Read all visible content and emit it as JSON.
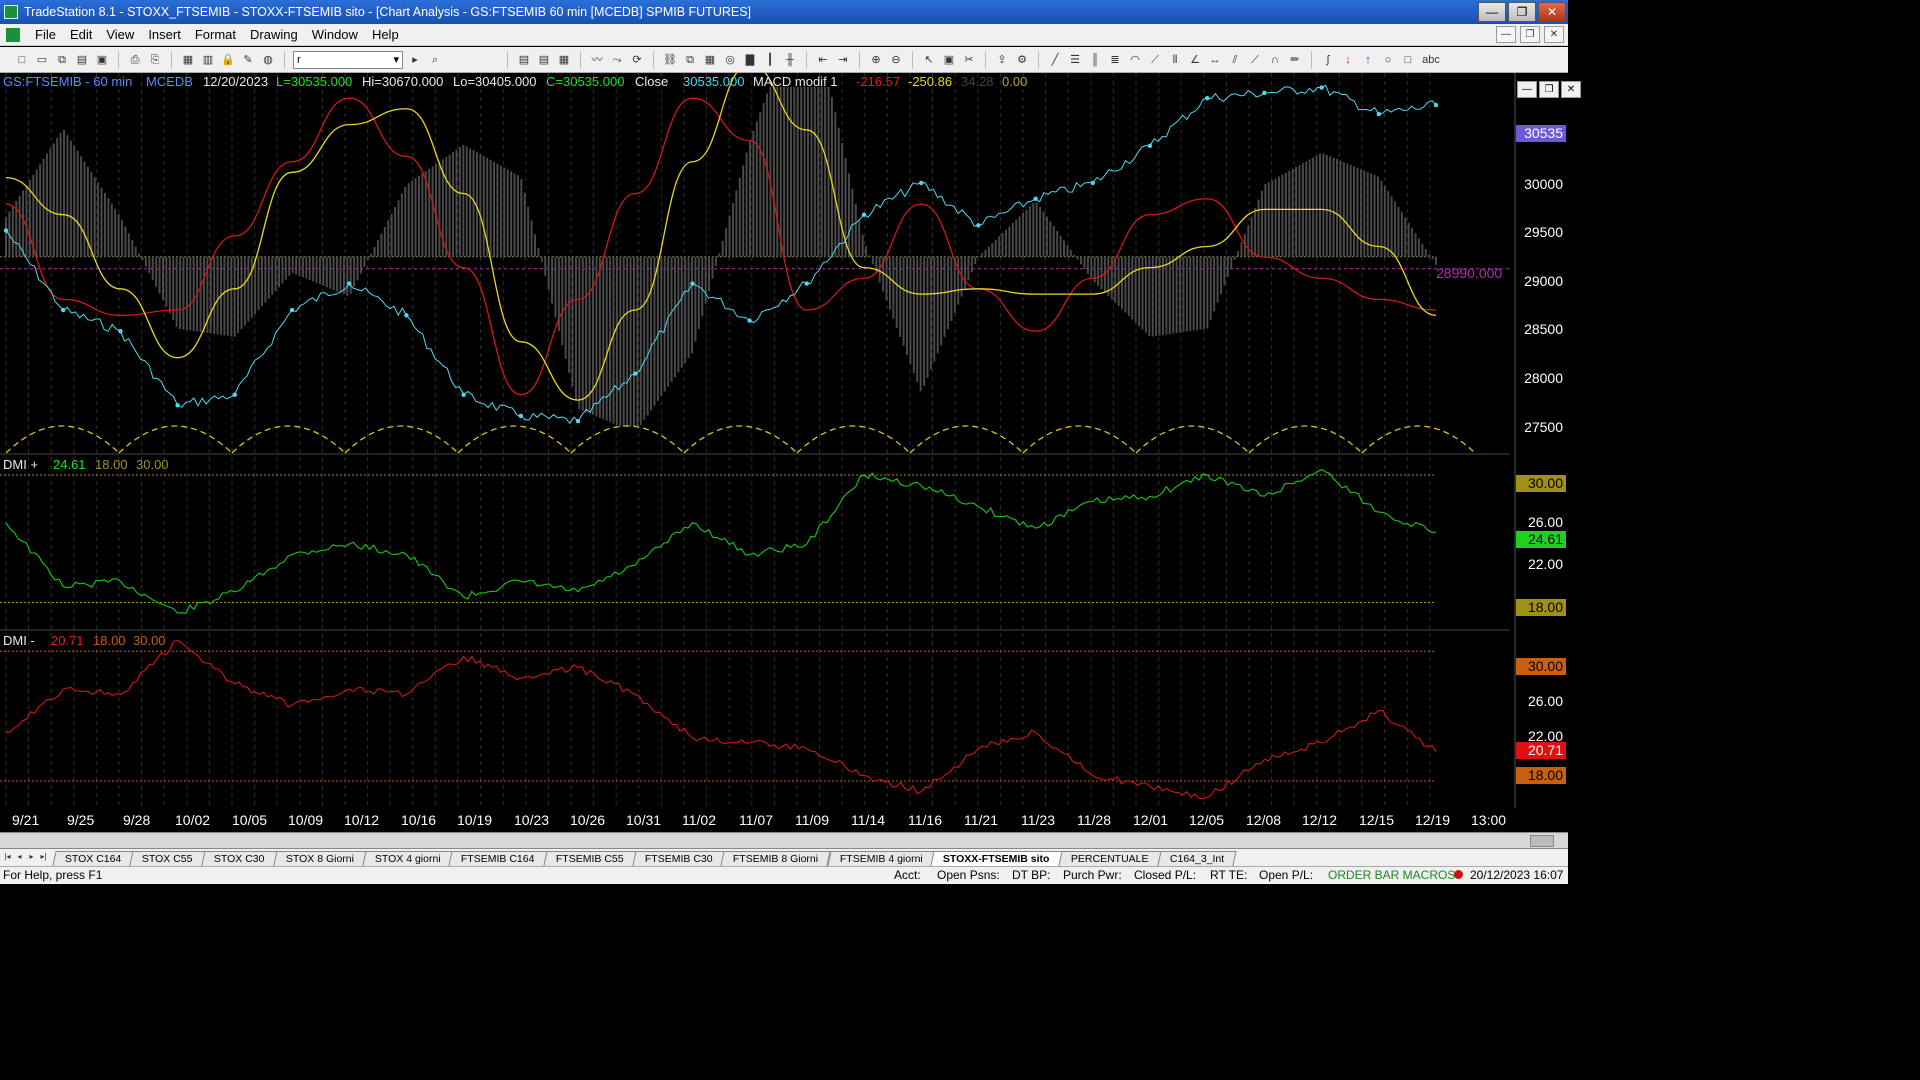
{
  "window": {
    "title": "TradeStation 8.1 - STOXX_FTSEMIB - STOXX-FTSEMIB sito - [Chart Analysis - GS:FTSEMIB  60 min  [MCEDB] SPMIB FUTURES]",
    "buttons": [
      "—",
      "❐",
      "✕"
    ]
  },
  "menu": {
    "items": [
      "File",
      "Edit",
      "View",
      "Insert",
      "Format",
      "Drawing",
      "Window",
      "Help"
    ]
  },
  "toolbar": {
    "combo_value": "r"
  },
  "chart_header": {
    "symbol": "GS:FTSEMIB - 60 min",
    "dataset": "MCEDB",
    "date": "12/20/2023",
    "low_label": "L=30535.000",
    "high_label": "Hi=30670.000",
    "lo_label": "Lo=30405.000",
    "close_label": "C=30535.000",
    "close_word": "Close",
    "close_value": "30535.000",
    "indicator": "MACD modif 1",
    "macd_values": [
      "-216.57",
      "-250.86",
      "34.28",
      "0.00"
    ]
  },
  "dmi_plus": {
    "label": "DMI +",
    "value": "24.61",
    "levels": [
      "18.00",
      "30.00"
    ]
  },
  "dmi_minus": {
    "label": "DMI -",
    "value": "20.71",
    "levels": [
      "18.00",
      "30.00"
    ]
  },
  "price_axis": {
    "last_price": "30535",
    "ticks": [
      "30000",
      "29500",
      "29000",
      "28500",
      "28000",
      "27500"
    ],
    "zero_label": "28990.000"
  },
  "dmi_plus_axis": {
    "ticks": [
      "30.00",
      "26.00",
      "22.00",
      "18.00"
    ],
    "current": "24.61"
  },
  "dmi_minus_axis": {
    "ticks": [
      "30.00",
      "26.00",
      "22.00",
      "18.00"
    ],
    "current": "20.71"
  },
  "x_axis": {
    "labels": [
      "9/21",
      "9/25",
      "9/28",
      "10/02",
      "10/05",
      "10/09",
      "10/12",
      "10/16",
      "10/19",
      "10/23",
      "10/26",
      "10/31",
      "11/02",
      "11/07",
      "11/09",
      "11/14",
      "11/16",
      "11/21",
      "11/23",
      "11/28",
      "12/01",
      "12/05",
      "12/08",
      "12/12",
      "12/15",
      "12/19",
      "13:00"
    ]
  },
  "tabs": [
    "STOX C164",
    "STOX C55",
    "STOX  C30",
    "STOX  8 Giorni",
    "STOX 4 giorni",
    "FTSEMIB C164",
    "FTSEMIB C55",
    "FTSEMIB C30",
    "FTSEMIB  8 Giorni",
    "FTSEMIB  4 giorni",
    "STOXX-FTSEMIB sito",
    "PERCENTUALE",
    "C164_3_Int"
  ],
  "active_tab": "STOXX-FTSEMIB sito",
  "status": {
    "help": "For Help, press F1",
    "acct": "Acct:",
    "open_psns": "Open Psns:",
    "dt_bp": "DT BP:",
    "purch_pwr": "Purch Pwr:",
    "closed_pl": "Closed P/L:",
    "rt_te": "RT TE:",
    "open_pl": "Open P/L:",
    "macros": "ORDER BAR  MACROS",
    "datetime": "20/12/2023 16:07"
  },
  "chart_data": [
    {
      "type": "line",
      "name": "price",
      "x": [
        "9/21",
        "9/25",
        "9/28",
        "10/02",
        "10/05",
        "10/09",
        "10/12",
        "10/16",
        "10/19",
        "10/23",
        "10/26",
        "10/31",
        "11/02",
        "11/07",
        "11/09",
        "11/14",
        "11/16",
        "11/21",
        "11/23",
        "11/28",
        "12/01",
        "12/05",
        "12/08",
        "12/12",
        "12/15",
        "12/19"
      ],
      "series": [
        {
          "values": [
            29350,
            28600,
            28400,
            27700,
            27800,
            28600,
            28850,
            28550,
            27800,
            27600,
            27550,
            28000,
            28850,
            28500,
            28850,
            29500,
            29800,
            29400,
            29650,
            29800,
            30150,
            30600,
            30650,
            30700,
            30450,
            30535
          ]
        },
        {
          "values": [
            29600,
            28700,
            28550,
            28600,
            29300,
            30000,
            30600,
            30050,
            29000,
            27800,
            28700,
            29700,
            30600,
            30200,
            28600,
            28900,
            29600,
            28800,
            28400,
            28900,
            29500,
            29650,
            29100,
            28900,
            28700,
            28600
          ]
        },
        {
          "values": [
            29850,
            29500,
            28800,
            28150,
            28800,
            29900,
            30350,
            30500,
            29700,
            28300,
            27750,
            28600,
            30000,
            30920,
            30300,
            29000,
            28750,
            28800,
            28750,
            28750,
            29000,
            29200,
            29550,
            29550,
            29200,
            28550
          ]
        }
      ],
      "ylim": [
        27250,
        30800
      ],
      "colors": [
        "#4fd8f0",
        "#d01818",
        "#e8d820"
      ]
    },
    {
      "type": "line",
      "name": "DMI +",
      "x": [
        "9/21",
        "9/25",
        "9/28",
        "10/02",
        "10/05",
        "10/09",
        "10/12",
        "10/16",
        "10/19",
        "10/23",
        "10/26",
        "10/31",
        "11/02",
        "11/07",
        "11/09",
        "11/14",
        "11/16",
        "11/21",
        "11/23",
        "11/28",
        "12/01",
        "12/05",
        "12/08",
        "12/12",
        "12/15",
        "12/19"
      ],
      "series": [
        {
          "values": [
            25.5,
            19.5,
            20.0,
            17.0,
            19.0,
            22.5,
            23.5,
            22.5,
            18.5,
            20.0,
            19.0,
            21.5,
            25.5,
            22.5,
            23.5,
            30.0,
            29.0,
            27.0,
            25.0,
            27.5,
            28.0,
            30.0,
            28.0,
            30.5,
            26.5,
            24.61
          ]
        }
      ],
      "ylim": [
        15.5,
        31.5
      ],
      "colors": [
        "#18c818"
      ]
    },
    {
      "type": "line",
      "name": "DMI -",
      "x": [
        "9/21",
        "9/25",
        "9/28",
        "10/02",
        "10/05",
        "10/09",
        "10/12",
        "10/16",
        "10/19",
        "10/23",
        "10/26",
        "10/31",
        "11/02",
        "11/07",
        "11/09",
        "11/14",
        "11/16",
        "11/21",
        "11/23",
        "11/28",
        "12/01",
        "12/05",
        "12/08",
        "12/12",
        "12/15",
        "12/19"
      ],
      "series": [
        {
          "values": [
            22.5,
            26.5,
            26.0,
            31.0,
            27.0,
            25.0,
            26.5,
            26.0,
            29.5,
            27.5,
            28.5,
            26.0,
            22.0,
            21.5,
            21.0,
            18.5,
            17.0,
            21.0,
            22.5,
            18.5,
            17.5,
            16.5,
            20.0,
            21.5,
            24.5,
            20.71
          ]
        }
      ],
      "ylim": [
        15.5,
        31.5
      ],
      "colors": [
        "#d01818"
      ]
    }
  ]
}
